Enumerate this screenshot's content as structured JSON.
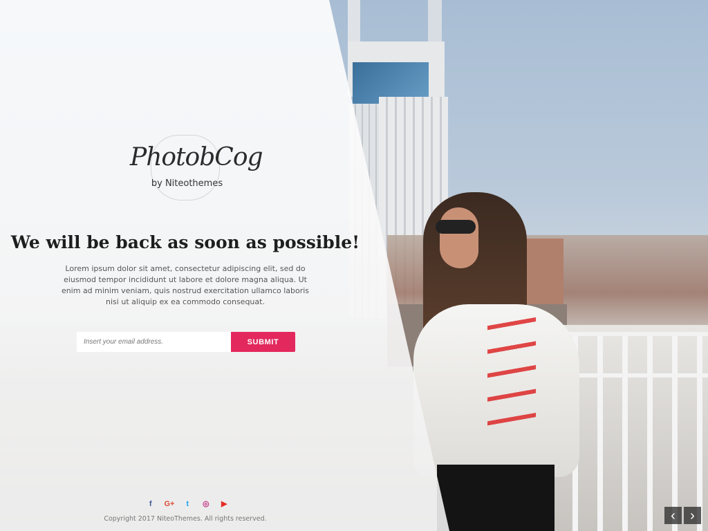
{
  "logo": {
    "title": "PhotobCog",
    "subtitle": "by Niteothemes"
  },
  "main": {
    "headline": "We will be back as soon as possible!",
    "paragraph": "Lorem ipsum dolor sit amet, consectetur adipiscing elit, sed do eiusmod tempor incididunt ut labore et dolore magna aliqua. Ut enim ad minim veniam, quis nostrud exercitation ullamco laboris nisi ut aliquip ex ea commodo consequat."
  },
  "subscribe": {
    "placeholder": "Insert your email address.",
    "button_label": "SUBMIT"
  },
  "social": [
    {
      "icon": "facebook-icon",
      "glyph": "f"
    },
    {
      "icon": "google-plus-icon",
      "glyph": "G+"
    },
    {
      "icon": "twitter-icon",
      "glyph": "t"
    },
    {
      "icon": "instagram-icon",
      "glyph": "◎"
    },
    {
      "icon": "youtube-icon",
      "glyph": "▶"
    }
  ],
  "footer": {
    "copyright": "Copyright 2017 NiteoThemes. All rights reserved."
  },
  "slider": {
    "prev_glyph": "‹",
    "next_glyph": "›"
  },
  "colors": {
    "accent": "#e3285e",
    "facebook": "#3b5998",
    "google_plus": "#dd4b39",
    "twitter": "#1da1f2",
    "instagram": "#c13584",
    "youtube": "#e52d27"
  }
}
